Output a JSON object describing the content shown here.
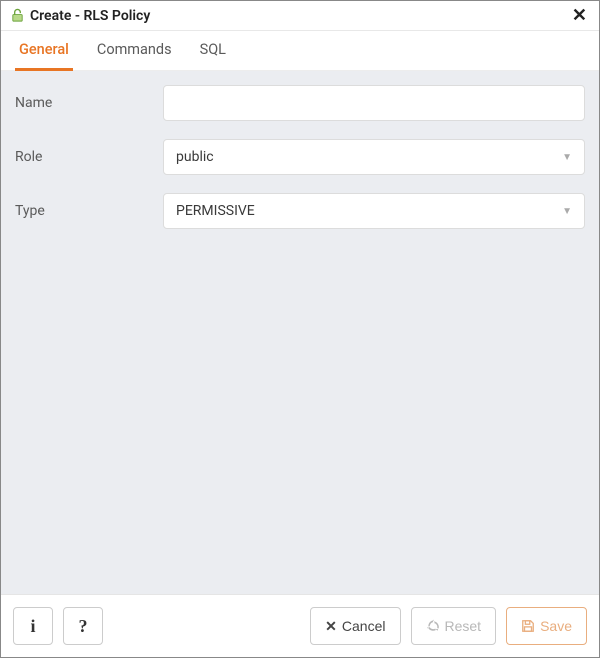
{
  "dialog": {
    "title": "Create - RLS Policy"
  },
  "tabs": {
    "general": "General",
    "commands": "Commands",
    "sql": "SQL"
  },
  "fields": {
    "name": {
      "label": "Name",
      "value": ""
    },
    "role": {
      "label": "Role",
      "value": "public"
    },
    "type": {
      "label": "Type",
      "value": "PERMISSIVE"
    }
  },
  "footer": {
    "cancel": "Cancel",
    "reset": "Reset",
    "save": "Save"
  }
}
